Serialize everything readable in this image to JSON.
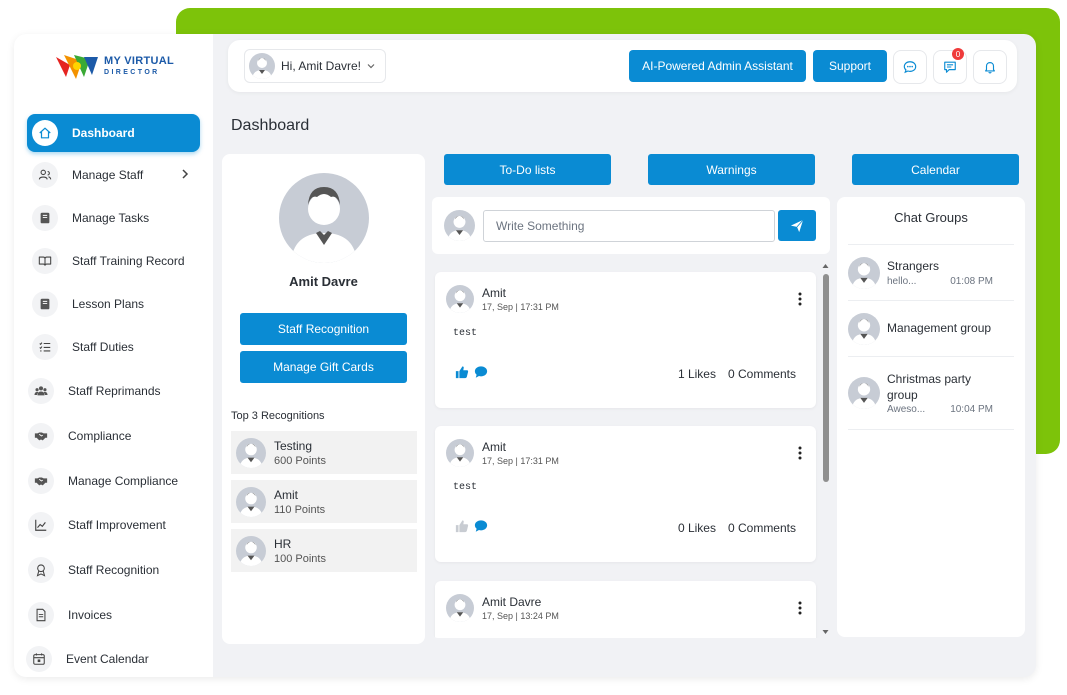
{
  "brand": {
    "logo_line1": "MY VIRTUAL",
    "logo_line2": "DIRECTOR",
    "colors": {
      "accent": "#0a8bd3",
      "frame_green": "#7dc30a",
      "badge_red": "#ef3b3b"
    }
  },
  "sidebar": {
    "items": [
      {
        "label": "Dashboard",
        "icon": "home-icon",
        "active": true
      },
      {
        "label": "Manage Staff",
        "icon": "users-icon",
        "has_submenu": true
      },
      {
        "label": "Manage Tasks",
        "icon": "book-icon"
      },
      {
        "label": "Staff Training Record",
        "icon": "open-book-icon"
      },
      {
        "label": "Lesson Plans",
        "icon": "book-icon"
      },
      {
        "label": "Staff Duties",
        "icon": "checklist-icon"
      },
      {
        "label": "Staff Reprimands",
        "icon": "group-icon"
      },
      {
        "label": "Compliance",
        "icon": "handshake-icon"
      },
      {
        "label": "Manage Compliance",
        "icon": "handshake-icon"
      },
      {
        "label": "Staff Improvement",
        "icon": "trend-chart-icon"
      },
      {
        "label": "Staff Recognition",
        "icon": "award-icon"
      },
      {
        "label": "Invoices",
        "icon": "document-icon"
      },
      {
        "label": "Event Calendar",
        "icon": "calendar-icon"
      }
    ]
  },
  "header": {
    "greeting": "Hi, Amit Davre!",
    "ai_button": "AI-Powered Admin Assistant",
    "support_button": "Support",
    "notification_count": "0"
  },
  "page": {
    "title": "Dashboard"
  },
  "profile": {
    "name": "Amit Davre",
    "staff_recognition_button": "Staff Recognition",
    "gift_cards_button": "Manage Gift Cards",
    "top3_title": "Top 3 Recognitions",
    "recognitions": [
      {
        "name": "Testing",
        "points": "600 Points"
      },
      {
        "name": "Amit",
        "points": "110 Points"
      },
      {
        "name": "HR",
        "points": "100 Points"
      }
    ]
  },
  "tabs": {
    "todo": "To-Do lists",
    "warnings": "Warnings",
    "calendar": "Calendar"
  },
  "compose": {
    "placeholder": "Write Something"
  },
  "feed": {
    "posts": [
      {
        "author": "Amit",
        "time": "17, Sep | 17:31 PM",
        "body": "test",
        "likes": "1 Likes",
        "comments": "0 Comments",
        "liked": true
      },
      {
        "author": "Amit",
        "time": "17, Sep | 17:31 PM",
        "body": "test",
        "likes": "0 Likes",
        "comments": "0 Comments",
        "liked": false
      },
      {
        "author": "Amit Davre",
        "time": "17, Sep | 13:24 PM",
        "body": "",
        "likes": "",
        "comments": "",
        "liked": false
      }
    ]
  },
  "chat": {
    "title": "Chat Groups",
    "groups": [
      {
        "name": "Strangers",
        "preview": "hello...",
        "time": "01:08 PM"
      },
      {
        "name": "Management group",
        "preview": "",
        "time": ""
      },
      {
        "name": "Christmas party group",
        "preview": "Aweso...",
        "time": "10:04 PM"
      }
    ]
  }
}
